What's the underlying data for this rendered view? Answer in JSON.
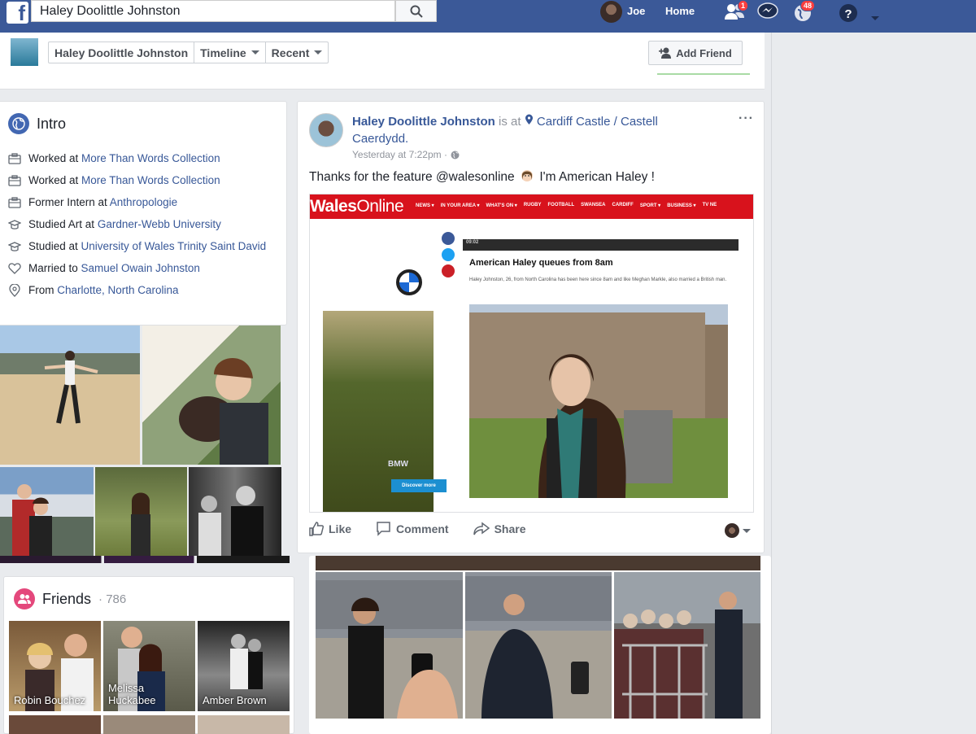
{
  "topbar": {
    "search_value": "Haley Doolittle Johnston",
    "user_name": "Joe",
    "home_label": "Home",
    "friend_requests_badge": "1",
    "notifications_badge": "48"
  },
  "profile_header": {
    "name": "Haley Doolittle Johnston",
    "timeline_label": "Timeline",
    "recent_label": "Recent",
    "add_friend_label": "Add Friend"
  },
  "intro": {
    "title": "Intro",
    "items": [
      {
        "icon": "briefcase-icon",
        "prefix": "Worked at ",
        "link": "More Than Words Collection"
      },
      {
        "icon": "briefcase-icon",
        "prefix": "Worked at ",
        "link": "More Than Words Collection"
      },
      {
        "icon": "briefcase-icon",
        "prefix": "Former Intern at ",
        "link": "Anthropologie"
      },
      {
        "icon": "graduation-cap-icon",
        "prefix": "Studied Art at ",
        "link": "Gardner-Webb University"
      },
      {
        "icon": "graduation-cap-icon",
        "prefix": "Studied at ",
        "link": "University of Wales Trinity Saint David"
      },
      {
        "icon": "heart-icon",
        "prefix": "Married to ",
        "link": "Samuel Owain Johnston"
      },
      {
        "icon": "location-pin-icon",
        "prefix": "From ",
        "link": "Charlotte, North Carolina"
      }
    ]
  },
  "friends": {
    "title": "Friends",
    "count": "· 786",
    "tiles": [
      {
        "name": "Robin Bouchez"
      },
      {
        "name": "Melissa Huckabee"
      },
      {
        "name": "Amber Brown"
      }
    ]
  },
  "post": {
    "author": "Haley Doolittle Johnston",
    "is_at": " is at ",
    "location": "Cardiff Castle / Castell Caerdydd.",
    "time": "Yesterday at 7:22pm ·",
    "more": "···",
    "message": "Thanks for the feature @walesonline",
    "message_tail": "I'm American Haley !",
    "embed": {
      "logo_bold": "Wales",
      "logo_light": "Online",
      "nav": [
        "NEWS ▾",
        "IN YOUR AREA ▾",
        "WHAT'S ON ▾",
        "RUGBY",
        "FOOTBALL",
        "SWANSEA",
        "CARDIFF",
        "SPORT ▾",
        "BUSINESS ▾",
        "TV NE"
      ],
      "live_time": "09:02",
      "article_title": "American Haley queues from 8am",
      "article_text": "Haley Johnston, 26, from North Carolina has been here since 8am and like Meghan Markle, also married a British man.",
      "discover_label": "Discover more",
      "ad_brand": "BMW"
    },
    "actions": {
      "like": "Like",
      "comment": "Comment",
      "share": "Share"
    }
  },
  "colors": {
    "brand": "#3b5998",
    "link": "#385898",
    "wales_red": "#d8121c"
  }
}
